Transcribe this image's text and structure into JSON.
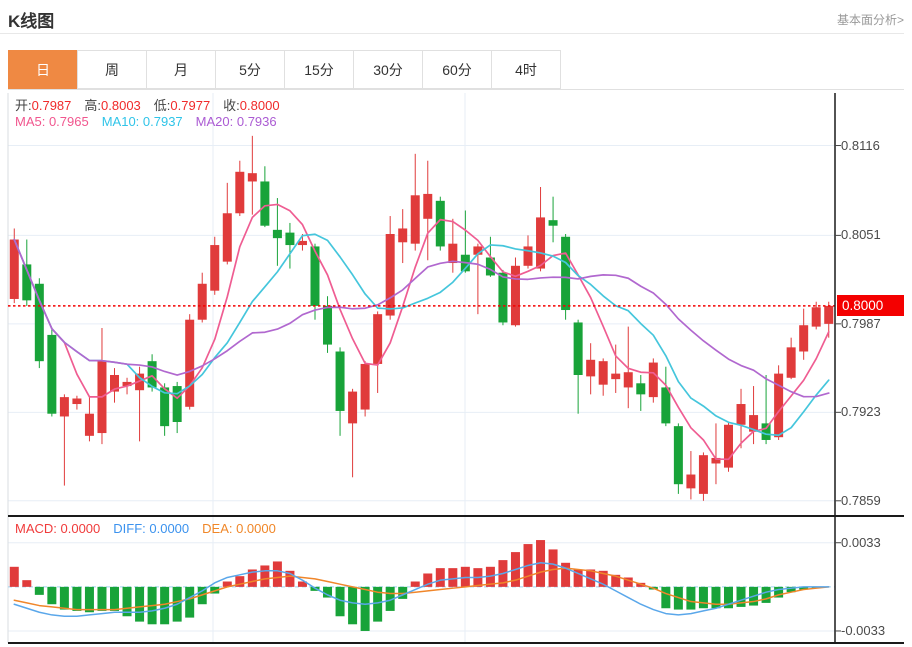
{
  "header": {
    "title": "K线图",
    "link": "基本面分析>"
  },
  "tabs": [
    {
      "label": "日",
      "active": true
    },
    {
      "label": "周",
      "active": false
    },
    {
      "label": "月",
      "active": false
    },
    {
      "label": "5分",
      "active": false
    },
    {
      "label": "15分",
      "active": false
    },
    {
      "label": "30分",
      "active": false
    },
    {
      "label": "60分",
      "active": false
    },
    {
      "label": "4时",
      "active": false
    }
  ],
  "legend": {
    "ohlc": [
      {
        "label": "开:",
        "value": "0.7987"
      },
      {
        "label": "高:",
        "value": "0.8003"
      },
      {
        "label": "低:",
        "value": "0.7977"
      },
      {
        "label": "收:",
        "value": "0.8000"
      }
    ],
    "ma": [
      {
        "label": "MA5:",
        "value": "0.7965",
        "color": "#f1568e"
      },
      {
        "label": "MA10:",
        "value": "0.7937",
        "color": "#2fc4e8"
      },
      {
        "label": "MA20:",
        "value": "0.7936",
        "color": "#ab5bd3"
      }
    ],
    "macd": [
      {
        "label": "MACD:",
        "value": "0.0000",
        "color": "#f03b3b"
      },
      {
        "label": "DIFF:",
        "value": "0.0000",
        "color": "#3b92ee"
      },
      {
        "label": "DEA:",
        "value": "0.0000",
        "color": "#f08728"
      }
    ]
  },
  "axes": {
    "price_labels": [
      {
        "text": "0.8116",
        "value": 0.8116
      },
      {
        "text": "0.8051",
        "value": 0.8051
      },
      {
        "text": "0.7987",
        "value": 0.7987
      },
      {
        "text": "0.7923",
        "value": 0.7923
      },
      {
        "text": "0.7859",
        "value": 0.7859
      }
    ],
    "current_price": {
      "text": "0.8000",
      "value": 0.8
    },
    "macd_labels": [
      {
        "text": "0.0033",
        "value": 0.0033
      },
      {
        "text": "-0.0033",
        "value": -0.0033
      }
    ]
  },
  "colors": {
    "up": "#e03b3b",
    "down": "#18a339",
    "legend_red": "#f02a2a",
    "ma5": "#ef5d92",
    "ma10": "#45c6dc",
    "ma20": "#b168cf",
    "diff": "#5aa7ea",
    "dea": "#f0862a",
    "price_line": "#f40000",
    "badge_bg": "#f40000",
    "grid": "#e7eef6",
    "left_edge": "#d9dde2",
    "frame": "#1a1a1a",
    "zero_dash": "#9fd3f2",
    "tab_active": "#ef8943"
  },
  "chart_data": {
    "type": "candlestick+macd",
    "price_panel": {
      "ylim": [
        0.7848,
        0.8154
      ],
      "gridlines": [
        0.8116,
        0.8051,
        0.7987,
        0.7923,
        0.7859
      ],
      "vertical_gridlines_x": [
        213,
        465
      ],
      "current_price": 0.8,
      "ma_periods": [
        5,
        10,
        20
      ],
      "candles": [
        [
          0.8005,
          0.8056,
          0.8002,
          0.8048
        ],
        [
          0.803,
          0.8048,
          0.8,
          0.8004
        ],
        [
          0.8016,
          0.802,
          0.7955,
          0.796
        ],
        [
          0.7979,
          0.7984,
          0.792,
          0.7922
        ],
        [
          0.792,
          0.7936,
          0.787,
          0.7934
        ],
        [
          0.7929,
          0.7935,
          0.7925,
          0.7933
        ],
        [
          0.7906,
          0.7934,
          0.7902,
          0.7922
        ],
        [
          0.7908,
          0.7984,
          0.79,
          0.796
        ],
        [
          0.7938,
          0.7955,
          0.793,
          0.795
        ],
        [
          0.7942,
          0.7948,
          0.7936,
          0.7945
        ],
        [
          0.7939,
          0.7956,
          0.7902,
          0.7951
        ],
        [
          0.796,
          0.7965,
          0.7938,
          0.7941
        ],
        [
          0.7941,
          0.7944,
          0.7906,
          0.7913
        ],
        [
          0.7942,
          0.7945,
          0.7908,
          0.7916
        ],
        [
          0.7927,
          0.7994,
          0.7925,
          0.799
        ],
        [
          0.799,
          0.8024,
          0.7988,
          0.8016
        ],
        [
          0.8011,
          0.805,
          0.8008,
          0.8044
        ],
        [
          0.8032,
          0.8089,
          0.803,
          0.8067
        ],
        [
          0.8067,
          0.8105,
          0.8065,
          0.8097
        ],
        [
          0.809,
          0.8123,
          0.8066,
          0.8096
        ],
        [
          0.809,
          0.8101,
          0.8057,
          0.8058
        ],
        [
          0.8055,
          0.8078,
          0.8029,
          0.8049
        ],
        [
          0.8053,
          0.806,
          0.8027,
          0.8044
        ],
        [
          0.8044,
          0.8052,
          0.804,
          0.8047
        ],
        [
          0.8043,
          0.8045,
          0.799,
          0.8
        ],
        [
          0.8,
          0.8007,
          0.7966,
          0.7972
        ],
        [
          0.7967,
          0.797,
          0.7906,
          0.7924
        ],
        [
          0.7915,
          0.794,
          0.7876,
          0.7938
        ],
        [
          0.7925,
          0.796,
          0.792,
          0.7958
        ],
        [
          0.7958,
          0.7996,
          0.7937,
          0.7994
        ],
        [
          0.7993,
          0.8065,
          0.799,
          0.8052
        ],
        [
          0.8046,
          0.807,
          0.8031,
          0.8056
        ],
        [
          0.8045,
          0.811,
          0.804,
          0.808
        ],
        [
          0.8063,
          0.8105,
          0.8033,
          0.8081
        ],
        [
          0.8076,
          0.8079,
          0.804,
          0.8043
        ],
        [
          0.8031,
          0.8063,
          0.8024,
          0.8045
        ],
        [
          0.8037,
          0.8069,
          0.8024,
          0.8025
        ],
        [
          0.8037,
          0.8045,
          0.7994,
          0.8043
        ],
        [
          0.8035,
          0.805,
          0.8021,
          0.8022
        ],
        [
          0.8024,
          0.8026,
          0.7986,
          0.7988
        ],
        [
          0.7986,
          0.8035,
          0.7985,
          0.8029
        ],
        [
          0.8029,
          0.8051,
          0.8027,
          0.8043
        ],
        [
          0.8027,
          0.8086,
          0.8025,
          0.8064
        ],
        [
          0.8062,
          0.8079,
          0.8046,
          0.8058
        ],
        [
          0.805,
          0.8052,
          0.799,
          0.7997
        ],
        [
          0.7988,
          0.799,
          0.7922,
          0.795
        ],
        [
          0.7949,
          0.7973,
          0.7936,
          0.7961
        ],
        [
          0.7943,
          0.7962,
          0.7935,
          0.796
        ],
        [
          0.7947,
          0.7972,
          0.7937,
          0.7951
        ],
        [
          0.7941,
          0.7985,
          0.7926,
          0.7952
        ],
        [
          0.7944,
          0.795,
          0.7924,
          0.7936
        ],
        [
          0.7934,
          0.7962,
          0.793,
          0.7959
        ],
        [
          0.7941,
          0.7956,
          0.7913,
          0.7915
        ],
        [
          0.7913,
          0.7915,
          0.7864,
          0.7871
        ],
        [
          0.7868,
          0.7895,
          0.786,
          0.7878
        ],
        [
          0.7864,
          0.7894,
          0.7859,
          0.7892
        ],
        [
          0.7886,
          0.7915,
          0.7871,
          0.789
        ],
        [
          0.7883,
          0.7916,
          0.788,
          0.7914
        ],
        [
          0.7914,
          0.794,
          0.7897,
          0.7929
        ],
        [
          0.7909,
          0.7942,
          0.79,
          0.7921
        ],
        [
          0.7915,
          0.795,
          0.79,
          0.7903
        ],
        [
          0.7905,
          0.7957,
          0.7903,
          0.7951
        ],
        [
          0.7948,
          0.7977,
          0.7947,
          0.797
        ],
        [
          0.7967,
          0.7998,
          0.7961,
          0.7986
        ],
        [
          0.7985,
          0.8003,
          0.7983,
          0.7999
        ],
        [
          0.7987,
          0.8003,
          0.7977,
          0.8
        ]
      ]
    },
    "macd_panel": {
      "ylim": [
        -0.0042,
        0.0053
      ],
      "gridlines": [
        0.0033,
        -0.0033
      ],
      "hist": [
        0.0015,
        0.0005,
        -0.0006,
        -0.0013,
        -0.0017,
        -0.0018,
        -0.0019,
        -0.0018,
        -0.0018,
        -0.0022,
        -0.0026,
        -0.0028,
        -0.0028,
        -0.0026,
        -0.0023,
        -0.0013,
        -0.0005,
        0.0004,
        0.0008,
        0.0013,
        0.0016,
        0.0019,
        0.0012,
        0.0004,
        -0.0003,
        -0.0008,
        -0.0022,
        -0.0028,
        -0.0033,
        -0.0026,
        -0.0018,
        -0.0009,
        0.0004,
        0.001,
        0.0014,
        0.0014,
        0.0015,
        0.0014,
        0.0015,
        0.002,
        0.0026,
        0.0032,
        0.0035,
        0.0028,
        0.0018,
        0.0013,
        0.0013,
        0.0012,
        0.0009,
        0.0007,
        0.0003,
        -0.0002,
        -0.0016,
        -0.0017,
        -0.0017,
        -0.0016,
        -0.0016,
        -0.0016,
        -0.0015,
        -0.0014,
        -0.0012,
        -0.0008,
        -0.0004,
        -0.0002,
        -0.0001,
        0.0
      ],
      "diff": [
        -0.0013,
        -0.0016,
        -0.0019,
        -0.0021,
        -0.0022,
        -0.0022,
        -0.0021,
        -0.002,
        -0.0019,
        -0.0019,
        -0.0019,
        -0.0018,
        -0.0016,
        -0.0013,
        -0.0008,
        -0.0003,
        0.0003,
        0.0007,
        0.0009,
        0.0011,
        0.0012,
        0.0012,
        0.001,
        0.0005,
        -0.0001,
        -0.0006,
        -0.001,
        -0.0012,
        -0.0013,
        -0.0012,
        -0.001,
        -0.0006,
        -0.0002,
        0.0002,
        0.0005,
        0.0006,
        0.0007,
        0.0007,
        0.0008,
        0.001,
        0.0013,
        0.0016,
        0.0018,
        0.0017,
        0.0014,
        0.001,
        0.0006,
        0.0002,
        -0.0003,
        -0.0008,
        -0.0013,
        -0.0017,
        -0.002,
        -0.0021,
        -0.002,
        -0.0018,
        -0.0016,
        -0.0013,
        -0.001,
        -0.0007,
        -0.0004,
        -0.0002,
        -0.0001,
        0.0,
        0.0,
        0.0
      ],
      "dea": [
        -0.001,
        -0.0012,
        -0.0014,
        -0.0015,
        -0.0016,
        -0.0017,
        -0.0017,
        -0.0017,
        -0.0017,
        -0.0016,
        -0.0015,
        -0.0014,
        -0.0013,
        -0.0011,
        -0.0009,
        -0.0006,
        -0.0003,
        0.0,
        0.0002,
        0.0004,
        0.0006,
        0.0007,
        0.0008,
        0.0007,
        0.0006,
        0.0004,
        0.0002,
        0.0,
        -0.0002,
        -0.0004,
        -0.0005,
        -0.0005,
        -0.0004,
        -0.0003,
        -0.0002,
        -0.0001,
        0.0,
        0.0001,
        0.0002,
        0.0003,
        0.0005,
        0.0008,
        0.0011,
        0.0013,
        0.0014,
        0.0013,
        0.0012,
        0.001,
        0.0008,
        0.0005,
        0.0002,
        -0.0001,
        -0.0005,
        -0.0008,
        -0.0011,
        -0.0012,
        -0.0013,
        -0.0013,
        -0.0012,
        -0.0011,
        -0.0009,
        -0.0006,
        -0.0004,
        -0.0002,
        -0.0001,
        0.0
      ]
    }
  }
}
